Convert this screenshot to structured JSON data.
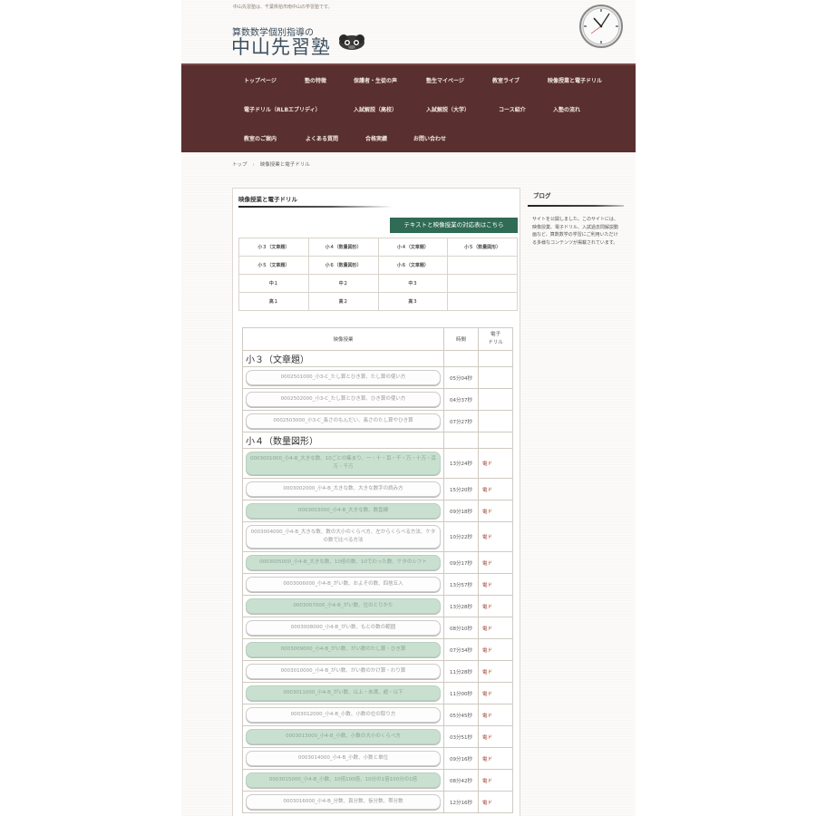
{
  "site": {
    "description": "中山先習塾は、千葉県柏市南中山の学習塾です。",
    "subtitle": "算数数学個別指導の",
    "title": "中山先習塾"
  },
  "nav": {
    "items": [
      {
        "label": "トップページ"
      },
      {
        "label": "塾の特徴"
      },
      {
        "label": "保護者・生徒の声"
      },
      {
        "label": "塾生マイページ"
      },
      {
        "label": "教室ライブ"
      },
      {
        "label": "映像授業と電子ドリル"
      },
      {
        "label": "電子ドリル（RLBエブリディ）"
      },
      {
        "label": "入試解説（高校）"
      },
      {
        "label": "入試解説（大学）"
      },
      {
        "label": "コース紹介"
      },
      {
        "label": "入塾の流れ"
      },
      {
        "label": "教室のご案内"
      },
      {
        "label": "よくある質問"
      },
      {
        "label": "合格実績"
      },
      {
        "label": "お問い合わせ"
      }
    ]
  },
  "breadcrumb": {
    "home": "トップ",
    "separator": "›",
    "current": "映像授業と電子ドリル"
  },
  "main": {
    "title": "映像授業と電子ドリル",
    "correspondence_button": "テキストと映像授業の対応表はこちら",
    "grades": [
      [
        "小３（文章題）",
        "小４（数量図形）",
        "小４（文章題）",
        "小５（数量図形）"
      ],
      [
        "小５（文章題）",
        "小６（数量図形）",
        "小６（文章題）",
        ""
      ],
      [
        "中１",
        "中２",
        "中３",
        ""
      ],
      [
        "高１",
        "高２",
        "高３",
        ""
      ]
    ],
    "table": {
      "header_video": "映像授業",
      "header_time": "時間",
      "header_drill": "電子\nドリル",
      "sections": [
        {
          "title": "小３（文章題）",
          "rows": [
            {
              "video": "0002501000_小3-C_たし算とひき算、たし算の使い方",
              "time": "05分04秒",
              "drill": "",
              "highlight": false
            },
            {
              "video": "0002502000_小3-C_たし算とひき算、ひき算の使い方",
              "time": "04分37秒",
              "drill": "",
              "highlight": false
            },
            {
              "video": "0002503000_小3-C_長さのもんだい、長さのたし算やひき算",
              "time": "07分27秒",
              "drill": "",
              "highlight": false
            }
          ]
        },
        {
          "title": "小４（数量図形）",
          "rows": [
            {
              "video": "0003001000_小4-B_大きな数、10ごとの集まり、一・十・百・千・万・十万・百万・千万",
              "time": "13分24秒",
              "drill": "電ド",
              "highlight": true
            },
            {
              "video": "0003002000_小4-B_大きな数、大きな数字の読み方",
              "time": "15分20秒",
              "drill": "電ド",
              "highlight": false
            },
            {
              "video": "0003003000_小4-B_大きな数、数直線",
              "time": "09分18秒",
              "drill": "電ド",
              "highlight": true
            },
            {
              "video": "0003004000_小4-B_大きな数、数の大小のくらべ方、左からくらべる方法、ケタの数で比べる方法",
              "time": "10分22秒",
              "drill": "電ド",
              "highlight": false
            },
            {
              "video": "0003005000_小4-B_大きな数、10倍の数、10でわった数、ケタのシフト",
              "time": "09分17秒",
              "drill": "電ド",
              "highlight": true
            },
            {
              "video": "0003006000_小4-B_がい数、およその数、四捨五入",
              "time": "13分57秒",
              "drill": "電ド",
              "highlight": false
            },
            {
              "video": "0003007000_小4-B_がい数、位のとりかた",
              "time": "13分28秒",
              "drill": "電ド",
              "highlight": true
            },
            {
              "video": "0003008000_小4-B_がい数、もとの数の範囲",
              "time": "08分10秒",
              "drill": "電ド",
              "highlight": false
            },
            {
              "video": "0003009000_小4-B_がい数、がい数のたし算・ひき算",
              "time": "07分34秒",
              "drill": "電ド",
              "highlight": true
            },
            {
              "video": "0003010000_小4-B_がい数、がい数のかけ算・わり算",
              "time": "11分28秒",
              "drill": "電ド",
              "highlight": false
            },
            {
              "video": "0003011000_小4-B_がい数、以上・未満、超・以下",
              "time": "11分00秒",
              "drill": "電ド",
              "highlight": true
            },
            {
              "video": "0003012000_小4-B_小数、小数の位の取り方",
              "time": "05分45秒",
              "drill": "電ド",
              "highlight": false
            },
            {
              "video": "0003013000_小4-B_小数、小数の大小のくらべ方",
              "time": "03分51秒",
              "drill": "電ド",
              "highlight": true
            },
            {
              "video": "0003014000_小4-B_小数、小数と単位",
              "time": "09分16秒",
              "drill": "電ド",
              "highlight": false
            },
            {
              "video": "0003015000_小4-B_小数、10倍100倍、10分の1倍100分の1倍",
              "time": "08分42秒",
              "drill": "電ド",
              "highlight": true
            },
            {
              "video": "0003016000_小4-B_分数、真分数、仮分数、帯分数",
              "time": "12分16秒",
              "drill": "電ド",
              "highlight": false
            }
          ]
        }
      ]
    }
  },
  "sidebar": {
    "title": "ブログ",
    "text": "サイトを公開しました。このサイトには、映像授業、電子ドリル、入試過去問解説動画など、算数数学の学習にご利用いただける多様なコンテンツが掲載されています。"
  },
  "colors": {
    "nav_bg": "#5a2f2f",
    "button_green": "#2f6b55",
    "row_highlight": "#c9e0d0",
    "drill_text": "#a0402f"
  },
  "icons": {
    "clock": "clock-icon",
    "mascot": "mascot-logo-icon"
  }
}
